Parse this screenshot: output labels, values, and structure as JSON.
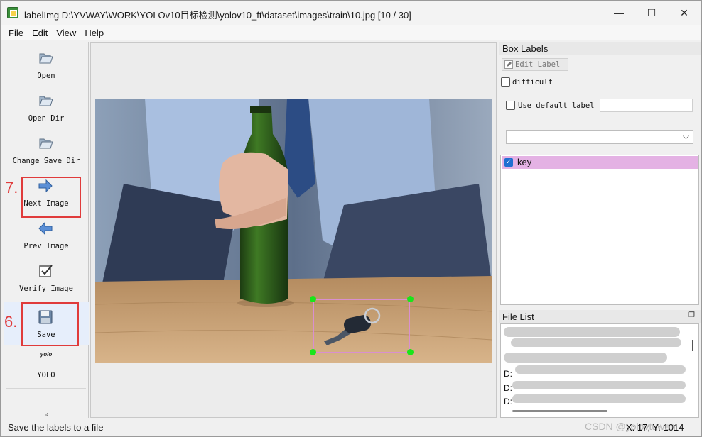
{
  "window": {
    "title": "labelImg D:\\YVWAY\\WORK\\YOLOv10目标检测\\yolov10_ft\\dataset\\images\\train\\10.jpg [10 / 30]",
    "minimize": "—",
    "maximize": "☐",
    "close": "✕"
  },
  "menu": [
    "File",
    "Edit",
    "View",
    "Help"
  ],
  "toolbar": {
    "items": [
      {
        "label": "Open",
        "icon": "folder-open-icon"
      },
      {
        "label": "Open Dir",
        "icon": "folder-open-icon"
      },
      {
        "label": "Change Save Dir",
        "icon": "folder-open-icon"
      },
      {
        "label": "Next Image",
        "icon": "arrow-right-icon"
      },
      {
        "label": "Prev Image",
        "icon": "arrow-left-icon"
      },
      {
        "label": "Verify Image",
        "icon": "checkbox-icon"
      },
      {
        "label": "Save",
        "icon": "floppy-disk-icon"
      },
      {
        "label": "YOLO",
        "icon": "yolo-format-icon",
        "icon_text": "yolo"
      }
    ],
    "annotations": {
      "next_step": "7.",
      "save_step": "6."
    },
    "more": "»"
  },
  "box_labels": {
    "title": "Box Labels",
    "edit_label_button": "Edit Label",
    "difficult_label": "difficult",
    "difficult_checked": false,
    "use_default_label": "Use default label",
    "use_default_checked": false,
    "default_label_value": "",
    "combo_value": "",
    "labels": [
      {
        "text": "key",
        "checked": true,
        "color": "#e4b2e4"
      }
    ]
  },
  "file_list": {
    "title": "File List",
    "visible_prefixes": [
      "D:",
      "D:",
      "D:"
    ]
  },
  "status": {
    "message": "Save the labels to a file",
    "coords": "X: 17; Y: 1014",
    "watermark": "CSDN @yolovtuwen"
  },
  "colors": {
    "annotation_red": "#e03b3b",
    "bbox_outline": "#d98fcf",
    "bbox_handles": "#19e619",
    "label_highlight": "#e4b2e4",
    "active_tool_bg": "#e6eefb"
  }
}
